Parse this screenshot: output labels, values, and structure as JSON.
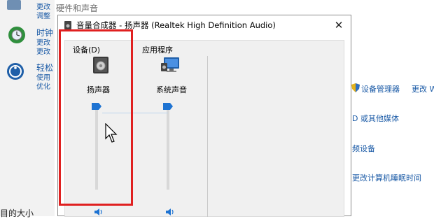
{
  "background": {
    "title": "硬件和声音",
    "left_items": [
      {
        "heading": "",
        "lines": [
          "更改",
          "调整"
        ]
      },
      {
        "heading": "时钟",
        "lines": [
          "更改",
          "更改"
        ]
      },
      {
        "heading": "轻松",
        "lines": [
          "使用",
          "优化"
        ]
      }
    ],
    "right_links": [
      {
        "text": "设备管理器",
        "icon": "shield-icon"
      },
      {
        "text": "更改 W"
      },
      {
        "text": "D 或其他媒体"
      },
      {
        "text": "频设备"
      },
      {
        "text": "更改计算机睡眠时间"
      }
    ],
    "bottom_text": "目的大小"
  },
  "mixer": {
    "title": "音量合成器 - 扬声器 (Realtek High Definition Audio)",
    "close_glyph": "✕",
    "device_group_label": "设备(D)",
    "app_group_label": "应用程序",
    "channels": [
      {
        "name": "扬声器",
        "icon": "speaker-icon",
        "level": 1.0
      },
      {
        "name": "系统声音",
        "icon": "system-sounds-icon",
        "level": 1.0
      }
    ]
  },
  "colors": {
    "accent": "#1e73d2",
    "highlight": "#e02020",
    "link": "#1a5aa6"
  }
}
